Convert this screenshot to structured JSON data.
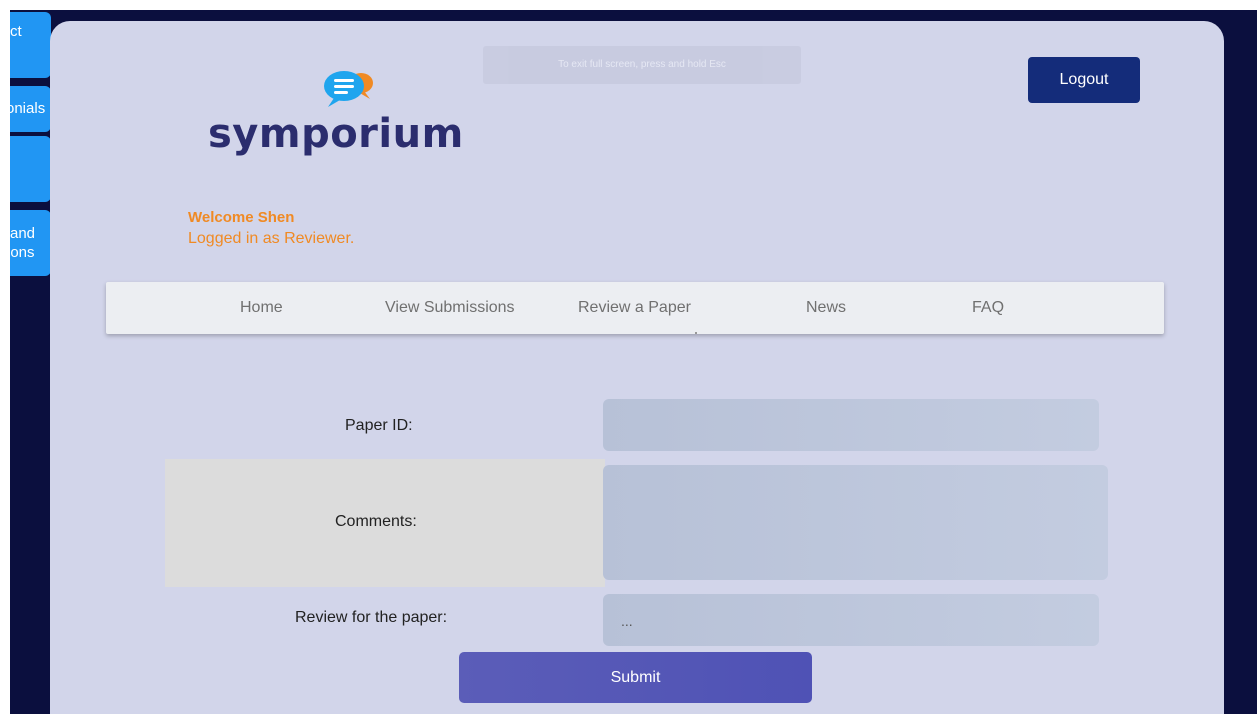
{
  "side_tabs": [
    {
      "label_lines": [
        "ct"
      ]
    },
    {
      "label_lines": [
        "onials"
      ]
    },
    {
      "label_lines": [
        ""
      ]
    },
    {
      "label_lines": [
        "and",
        "ions"
      ]
    }
  ],
  "header": {
    "logo_text": "symporium",
    "fullscreen_hint": "To exit full screen, press and hold Esc",
    "logout_label": "Logout"
  },
  "user": {
    "welcome": "Welcome Shen",
    "role_text": "Logged in as Reviewer."
  },
  "nav": {
    "items": [
      {
        "label": "Home"
      },
      {
        "label": "View Submissions"
      },
      {
        "label": "Review a Paper"
      },
      {
        "label": "News"
      },
      {
        "label": "FAQ"
      }
    ]
  },
  "form": {
    "paper_id_label": "Paper ID:",
    "paper_id_value": "",
    "comments_label": "Comments:",
    "comments_value": "",
    "review_label": "Review for the paper:",
    "review_selected": "...",
    "submit_label": "Submit"
  },
  "colors": {
    "page_bg": "#0b0f3e",
    "card_bg": "#d2d5ea",
    "accent_orange": "#f08a24",
    "logout_bg": "#142c7a",
    "submit_bg": "#5456b7",
    "side_tab_bg": "#2196f3"
  }
}
